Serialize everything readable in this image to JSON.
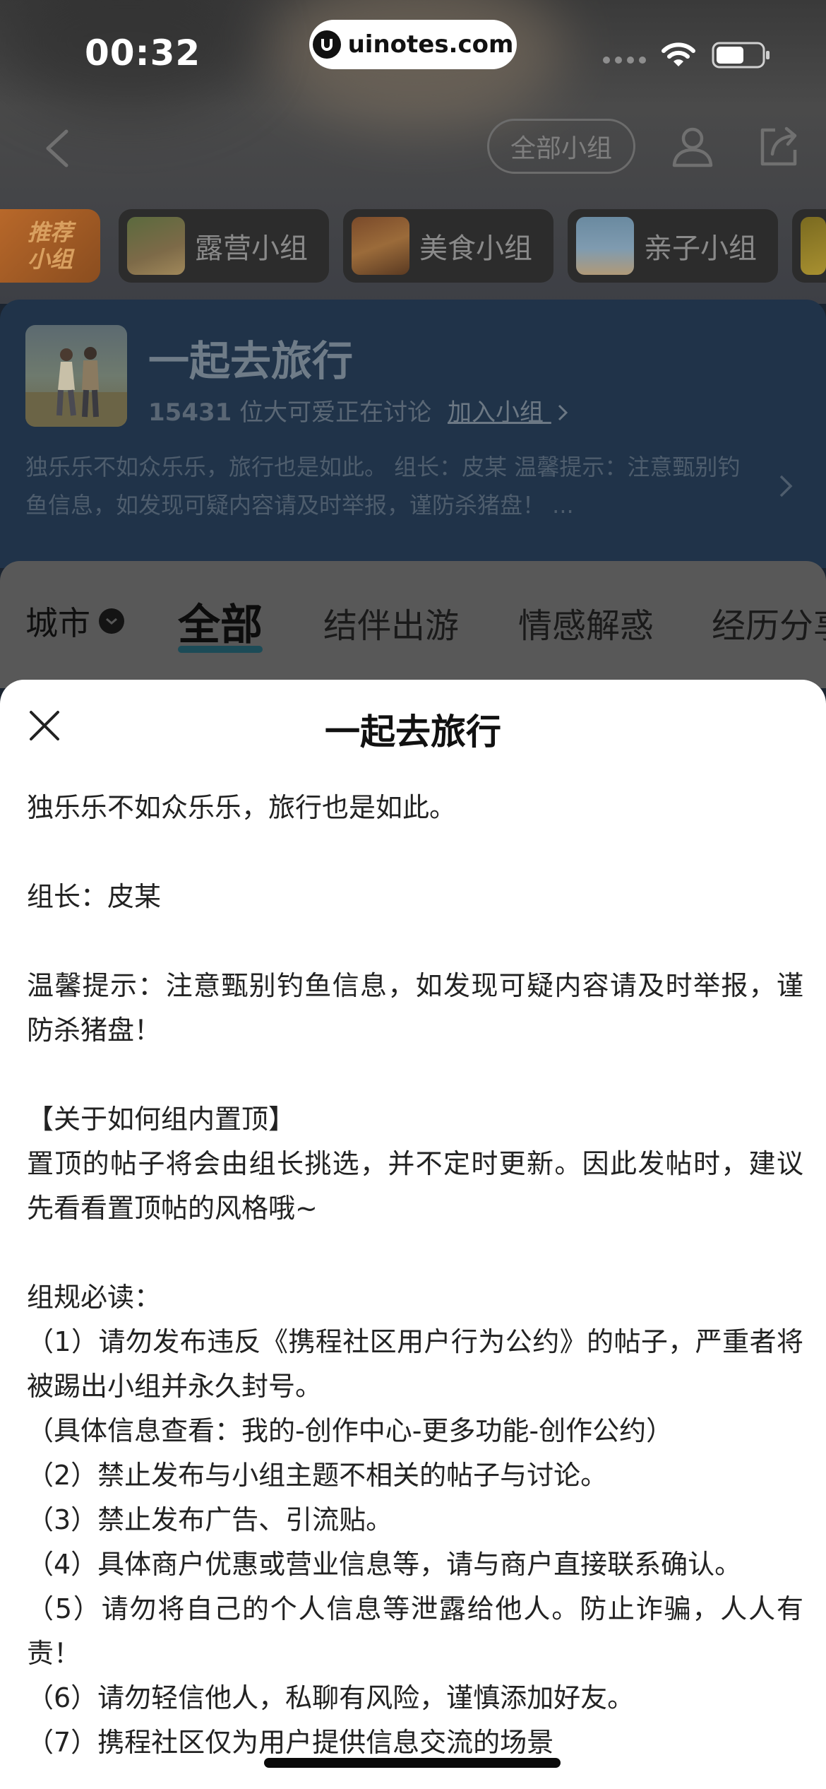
{
  "status_bar": {
    "time": "00:32",
    "url_badge": "uinotes.com"
  },
  "nav": {
    "all_groups_label": "全部小组"
  },
  "chips": {
    "recommend_line1": "推荐",
    "recommend_line2": "小组",
    "items": [
      {
        "label": "露营小组"
      },
      {
        "label": "美食小组"
      },
      {
        "label": "亲子小组"
      }
    ]
  },
  "group": {
    "name": "一起去旅行",
    "member_count": "15431",
    "member_suffix": "位大可爱正在讨论",
    "join_label": "加入小组",
    "description": "独乐乐不如众乐乐，旅行也是如此。 组长：皮某 温馨提示：注意甄别钓鱼信息，如发现可疑内容请及时举报，谨防杀猪盘！ ..."
  },
  "tabs": {
    "city": "城市",
    "items": [
      "全部",
      "结伴出游",
      "情感解惑",
      "经历分享"
    ],
    "active_index": 0
  },
  "sheet": {
    "title": "一起去旅行",
    "paragraphs": [
      "独乐乐不如众乐乐，旅行也是如此。",
      "",
      "组长：皮某",
      "",
      "温馨提示：注意甄别钓鱼信息，如发现可疑内容请及时举报，谨防杀猪盘！",
      "",
      "【关于如何组内置顶】",
      "置顶的帖子将会由组长挑选，并不定时更新。因此发帖时，建议先看看置顶帖的风格哦~",
      "",
      "组规必读：",
      "（1）请勿发布违反《携程社区用户行为公约》的帖子，严重者将被踢出小组并永久封号。",
      "（具体信息查看：我的-创作中心-更多功能-创作公约）",
      "（2）禁止发布与小组主题不相关的帖子与讨论。",
      "（3）禁止发布广告、引流贴。",
      "（4）具体商户优惠或营业信息等，请与商户直接联系确认。",
      "（5）请勿将自己的个人信息等泄露给他人。防止诈骗，人人有责！",
      "（6）请勿轻信他人，私聊有风险，谨慎添加好友。",
      "（7）携程社区仅为用户提供信息交流的场景"
    ]
  },
  "colors": {
    "sheet_bg": "#ffffff",
    "card_bg": "#203349",
    "tab_underline": "#1c4b57"
  }
}
